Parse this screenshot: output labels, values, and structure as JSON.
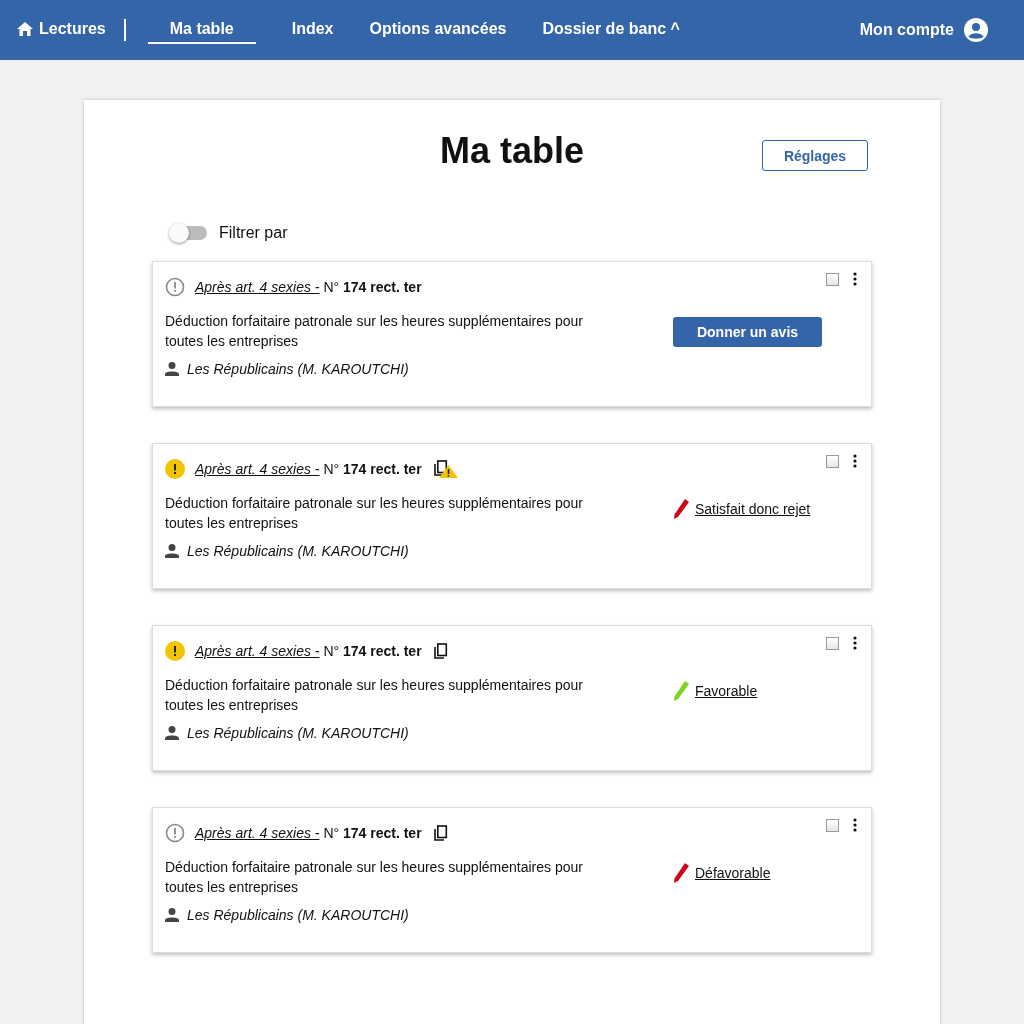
{
  "nav": {
    "items": [
      {
        "label": "Lectures",
        "kind": "home",
        "selected": false
      },
      {
        "label": "Ma table",
        "kind": "link",
        "selected": true
      },
      {
        "label": "Index",
        "kind": "link",
        "selected": false
      },
      {
        "label": "Options avancées",
        "kind": "link",
        "selected": false
      },
      {
        "label": "Dossier de banc ^",
        "kind": "link",
        "selected": false
      }
    ],
    "account": "Mon compte"
  },
  "page": {
    "title": "Ma table",
    "settings_button": "Réglages",
    "filter": {
      "label": "Filtrer par",
      "on": false
    }
  },
  "cards": [
    {
      "status": {
        "kind": "neutral"
      },
      "place": "Après art. 4 sexies -",
      "number_prefix": "N°",
      "number": "174 rect. ter",
      "summary": "Déduction forfaitaire patronale sur les heures supplémentaires pour toutes les entreprises",
      "author": "Les Républicains (M. KAROUTCHI)",
      "checked": false,
      "action": {
        "kind": "button",
        "label": "Donner un avis"
      }
    },
    {
      "status": {
        "kind": "warning"
      },
      "place": "Après art. 4 sexies -",
      "number_prefix": "N°",
      "number": "174 rect. ter",
      "duplicate": {
        "kind": "copy-warning"
      },
      "summary": "Déduction forfaitaire patronale sur les heures supplémentaires pour toutes les entreprises",
      "author": "Les Républicains (M. KAROUTCHI)",
      "checked": false,
      "action": {
        "kind": "avis",
        "label": "Satisfait donc rejet",
        "color": "#d0021b"
      }
    },
    {
      "status": {
        "kind": "warning"
      },
      "place": "Après art. 4 sexies -",
      "number_prefix": "N°",
      "number": "174 rect. ter",
      "duplicate": {
        "kind": "copy"
      },
      "summary": "Déduction forfaitaire patronale sur les heures supplémentaires pour toutes les entreprises",
      "author": "Les Républicains (M. KAROUTCHI)",
      "checked": false,
      "action": {
        "kind": "avis",
        "label": "Favorable",
        "color": "#7ed321"
      }
    },
    {
      "status": {
        "kind": "neutral"
      },
      "place": "Après art. 4 sexies -",
      "number_prefix": "N°",
      "number": "174 rect. ter",
      "duplicate": {
        "kind": "copy"
      },
      "summary": "Déduction forfaitaire patronale sur les heures supplémentaires pour toutes les entreprises",
      "author": "Les Républicains (M. KAROUTCHI)",
      "checked": false,
      "action": {
        "kind": "avis",
        "label": "Défavorable",
        "color": "#d0021b"
      }
    }
  ]
}
